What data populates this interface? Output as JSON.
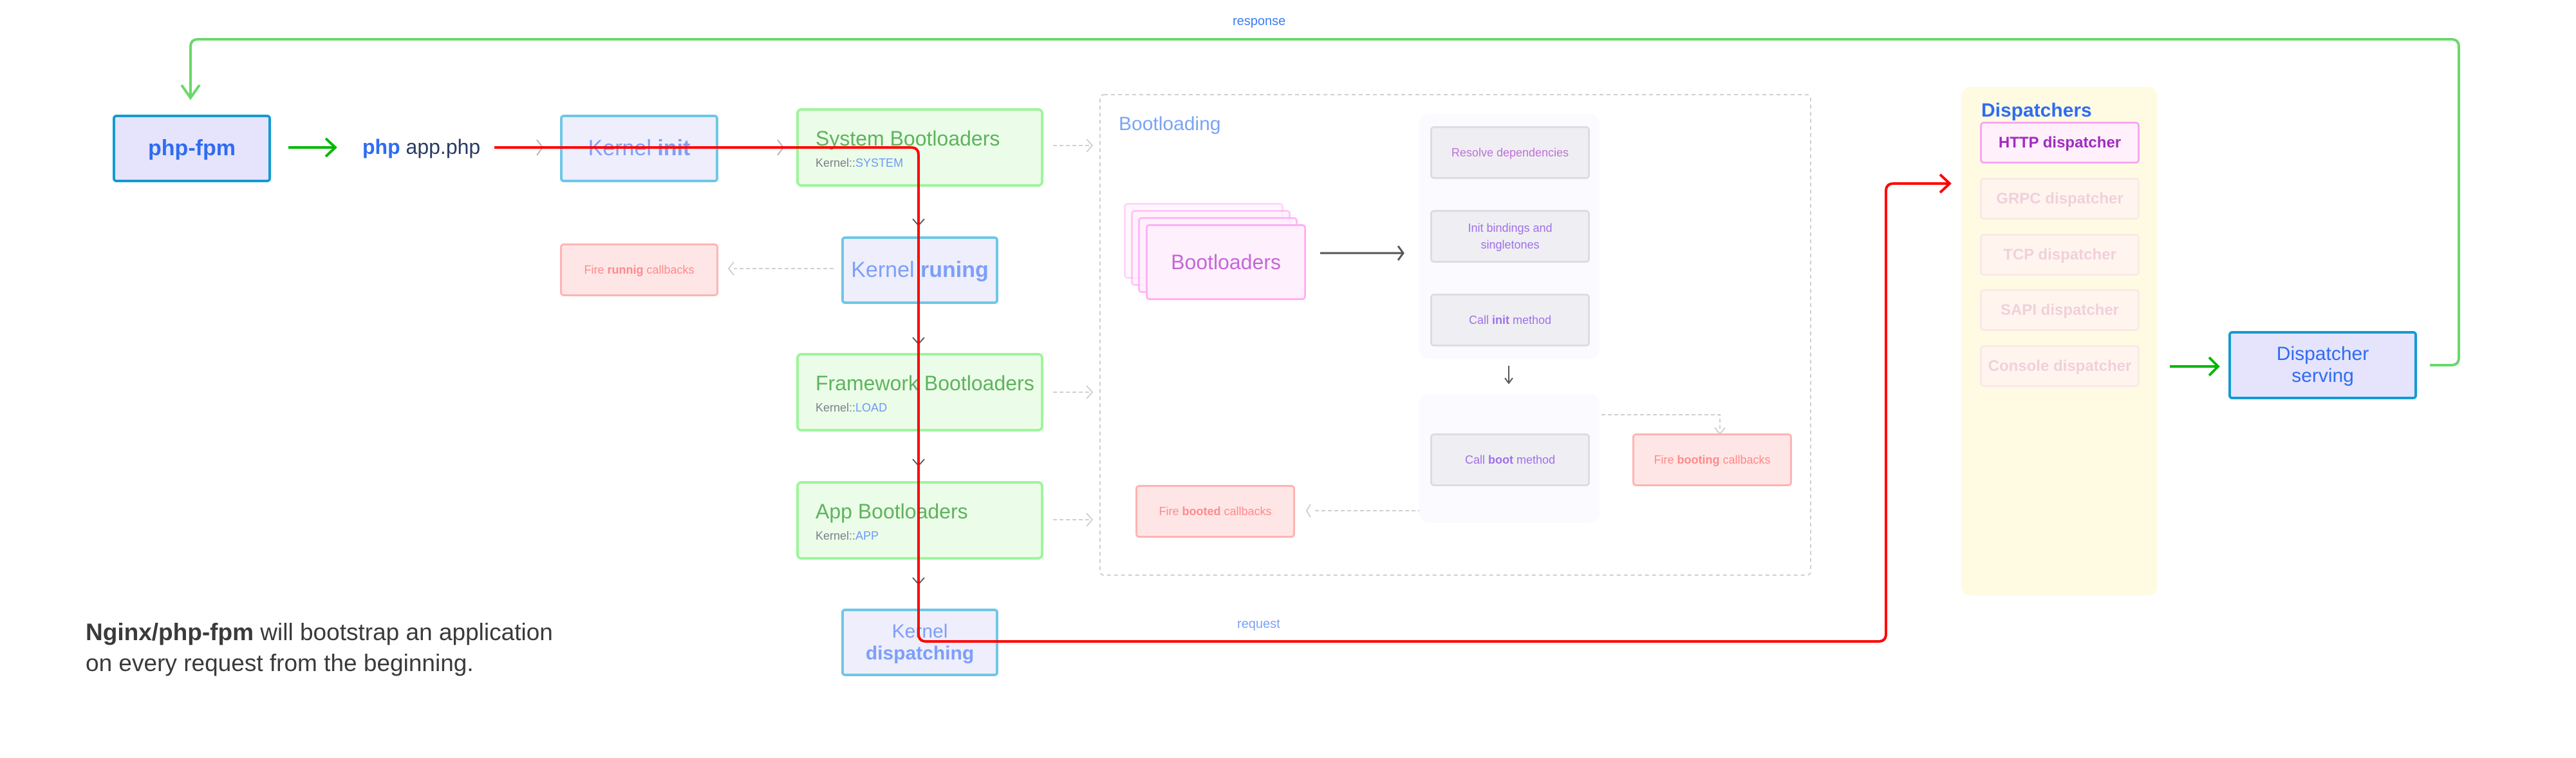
{
  "labels": {
    "response": "response",
    "request": "request"
  },
  "nodes": {
    "php_fpm": "php-fpm",
    "php_cmd": {
      "keyword": "php",
      "rest": " app.php"
    },
    "kernel_init": {
      "a": "Kernel ",
      "b": "init"
    },
    "kernel_runing": {
      "a": "Kernel ",
      "b": "runing"
    },
    "kernel_dispatching": {
      "a": "Kernel",
      "b": "dispatching"
    },
    "fire_runnig": {
      "a": "Fire ",
      "b": "runnig",
      "c": " callbacks"
    },
    "dispatcher_serving": "Dispatcher serving"
  },
  "bootloader_groups": [
    {
      "title": "System Bootloaders",
      "prefix": "Kernel::",
      "constant": "SYSTEM"
    },
    {
      "title": "Framework Bootloaders",
      "prefix": "Kernel::",
      "constant": "LOAD"
    },
    {
      "title": "App Bootloaders",
      "prefix": "Kernel::",
      "constant": "APP"
    }
  ],
  "bootloading": {
    "title": "Bootloading",
    "stack_label": "Bootloaders",
    "steps": [
      {
        "text": "Resolve dependencies"
      },
      {
        "text": "Init bindings and singletones"
      },
      {
        "a": "Call ",
        "b": "init",
        "c": " method"
      },
      {
        "a": "Call ",
        "b": "boot",
        "c": " method"
      }
    ],
    "fire_booting": {
      "a": "Fire ",
      "b": "booting",
      "c": " callbacks"
    },
    "fire_booted": {
      "a": "Fire ",
      "b": "booted",
      "c": " callbacks"
    }
  },
  "dispatchers": {
    "title": "Dispatchers",
    "items": [
      {
        "label": "HTTP dispatcher",
        "active": true
      },
      {
        "label": "GRPC dispatcher",
        "active": false
      },
      {
        "label": "TCP dispatcher",
        "active": false
      },
      {
        "label": "SAPI dispatcher",
        "active": false
      },
      {
        "label": "Console dispatcher",
        "active": false
      }
    ]
  },
  "footer": {
    "bold": "Nginx/php-fpm",
    "line1": " will bootstrap an application",
    "line2": "on every request from the beginning."
  },
  "colors": {
    "response_line": "#69d86a",
    "request_line": "#ff0000",
    "flow_arrow": "#00b800",
    "accent_blue": "#2f6cf0"
  }
}
